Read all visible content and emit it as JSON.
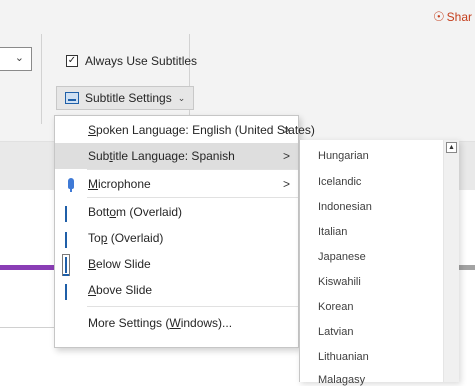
{
  "ribbon": {
    "share_label": "Shar",
    "always_use_subtitles": {
      "label": "Always Use Subtitles",
      "checked": true
    },
    "subtitle_settings_label": "Subtitle Settings"
  },
  "menu": {
    "items": [
      {
        "label_pre": "",
        "ul": "S",
        "label_post": "poken Language: English (United States)",
        "arrow": ">"
      },
      {
        "label_pre": "Sub",
        "ul": "t",
        "label_post": "itle Language: Spanish",
        "arrow": ">"
      },
      {
        "label_pre": "",
        "ul": "M",
        "label_post": "icrophone",
        "arrow": ">"
      },
      {
        "label_pre": "Bott",
        "ul": "o",
        "label_post": "m (Overlaid)"
      },
      {
        "label_pre": "To",
        "ul": "p",
        "label_post": " (Overlaid)"
      },
      {
        "label_pre": "",
        "ul": "B",
        "label_post": "elow Slide"
      },
      {
        "label_pre": "",
        "ul": "A",
        "label_post": "bove Slide"
      },
      {
        "label_pre": "More Settings (",
        "ul": "W",
        "label_post": "indows)..."
      }
    ]
  },
  "languages": [
    "Hungarian",
    "Icelandic",
    "Indonesian",
    "Italian",
    "Japanese",
    "Kiswahili",
    "Korean",
    "Latvian",
    "Lithuanian",
    "Malagasy"
  ],
  "colors": {
    "accent": "#1f5fa8",
    "share": "#c43e1c",
    "slide_bar": "#8a3db5"
  }
}
